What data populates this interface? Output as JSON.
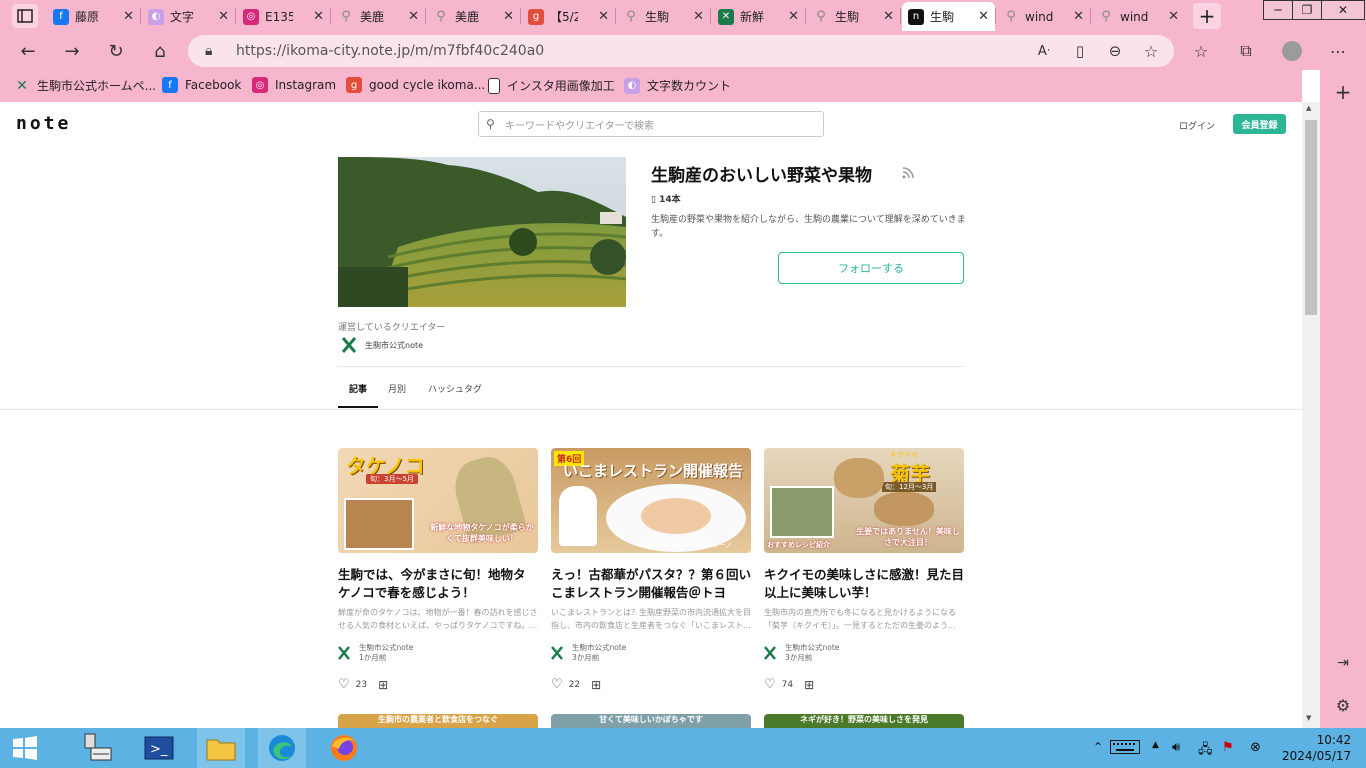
{
  "browser": {
    "tabs": [
      {
        "title": "藤原",
        "icon": "facebook-icon",
        "color": "#1877f2",
        "glyph": "f"
      },
      {
        "title": "文字",
        "icon": "moji-count-icon",
        "color": "#c9a0e8",
        "glyph": "◐"
      },
      {
        "title": "E135",
        "icon": "instagram-icon",
        "color": "#d6297a",
        "glyph": "◎"
      },
      {
        "title": "美鹿",
        "icon": "search-icon",
        "color": "#888",
        "glyph": "⚲"
      },
      {
        "title": "美鹿",
        "icon": "search-icon",
        "color": "#888",
        "glyph": "⚲"
      },
      {
        "title": "【5/25",
        "icon": "goodcycle-icon",
        "color": "#e04f3c",
        "glyph": "g"
      },
      {
        "title": "生駒",
        "icon": "search-icon",
        "color": "#888",
        "glyph": "⚲"
      },
      {
        "title": "新鮮",
        "icon": "ikoma-icon",
        "color": "#1d7a4a",
        "glyph": "✕"
      },
      {
        "title": "生駒",
        "icon": "search-icon",
        "color": "#888",
        "glyph": "⚲"
      },
      {
        "title": "生駒",
        "icon": "note-icon",
        "color": "#111",
        "glyph": "n"
      },
      {
        "title": "windo",
        "icon": "search-icon",
        "color": "#888",
        "glyph": "⚲"
      },
      {
        "title": "windo",
        "icon": "search-icon",
        "color": "#888",
        "glyph": "⚲"
      }
    ],
    "active_tab": 9,
    "url": "https://ikoma-city.note.jp/m/m7fbf40c240a0",
    "bookmarks": [
      {
        "label": "生駒市公式ホームペ...",
        "icon": "ikoma-icon",
        "color": "#1d7a4a",
        "glyph": "✕"
      },
      {
        "label": "Facebook",
        "icon": "facebook-icon",
        "color": "#1877f2",
        "glyph": "f"
      },
      {
        "label": "Instagram",
        "icon": "instagram-icon",
        "color": "#d6297a",
        "glyph": "◎"
      },
      {
        "label": "good cycle ikoma...",
        "icon": "goodcycle-icon",
        "color": "#e04f3c",
        "glyph": "g"
      },
      {
        "label": "インスタ用画像加工",
        "icon": "document-icon",
        "color": "#ffffff",
        "glyph": ""
      },
      {
        "label": "文字数カウント",
        "icon": "moji-count-icon",
        "color": "#c9a0e8",
        "glyph": "◐"
      }
    ]
  },
  "note": {
    "logo": "note",
    "search_placeholder": "キーワードやクリエイターで検索",
    "login_label": "ログイン",
    "signup_label": "会員登録"
  },
  "magazine": {
    "title": "生駒産のおいしい野菜や果物",
    "count": "14本",
    "description": "生駒産の野菜や果物を紹介しながら、生駒の農業について理解を深めていきます。",
    "follow_label": "フォローする",
    "operators_label": "運営しているクリエイター",
    "creator_name": "生駒市公式note"
  },
  "page_tabs": [
    "記事",
    "月別",
    "ハッシュタグ"
  ],
  "articles": [
    {
      "title": "生駒では、今がまさに旬！地物タケノコで春を感じよう！",
      "excerpt": "鮮度が命のタケノコは、地物が一番！春の訪れを感じさせる人気の食材といえば、やっぱりタケノコですね。...",
      "author": "生駒市公式note",
      "time": "1か月前",
      "likes": "23",
      "thumb_heading": "タケノコ",
      "thumb_sub": "旬：3月～5月",
      "thumb_caption": "新鮮な地物タケノコが柔らかくて抜群美味しい！"
    },
    {
      "title": "えっ！古都華がパスタ？？第６回いこまレストラン開催報告＠トヨジ...",
      "excerpt": "いこまレストランとは？生駒産野菜の市内流通拡大を目指し、市内の飲食店と生産者をつなぐ「いこまレスト...",
      "author": "生駒市公式note",
      "time": "3か月前",
      "likes": "22",
      "thumb_badge": "第6回",
      "thumb_heading": "いこまレストラン開催報告",
      "thumb_caption": "2024.2.5 @トヨジクリーノ"
    },
    {
      "title": "キクイモの美味しさに感激！見た目以上に美味しい芋！",
      "excerpt": "生駒市内の直売所でも冬になると見かけるようになる「菊芋（キクイモ）」。一見するとただの生姜のよう...",
      "author": "生駒市公式note",
      "time": "3か月前",
      "likes": "74",
      "thumb_kana": "キクイモ",
      "thumb_heading": "菊芋",
      "thumb_sub": "旬：12月～3月",
      "thumb_caption": "生姜ではありません！美味しさで大注目！",
      "thumb_caption2": "おすすめレシピ紹介"
    }
  ],
  "next_row_captions": [
    "生駒市の農業者と飲食店をつなぐ",
    "甘くて美味しいかぼちゃです",
    "ネギが好き！野菜の美味しさを発見"
  ],
  "clock": {
    "time": "10:42",
    "date": "2024/05/17"
  }
}
